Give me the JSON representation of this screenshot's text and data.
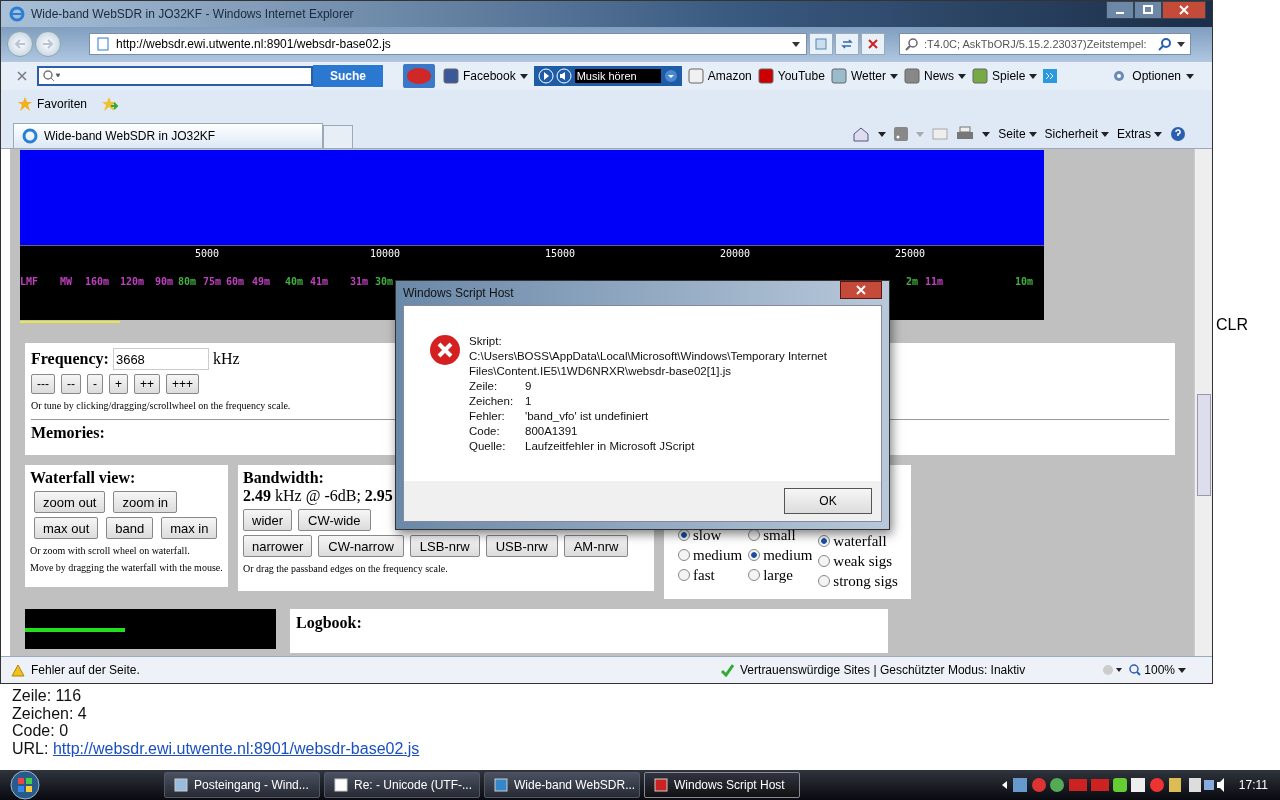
{
  "background_window": {
    "lines": [
      "Zeile: 116",
      "Zeichen: 4",
      "Code: 0"
    ],
    "url_label": "URL:",
    "url": "http://websdr.ewi.utwente.nl:8901/websdr-base02.js",
    "side_text": "CLR"
  },
  "ie_window": {
    "title": "Wide-band WebSDR in JO32KF - Windows Internet Explorer",
    "address": "http://websdr.ewi.utwente.nl:8901/websdr-base02.js",
    "search_value": ":T4.0C; AskTbORJ/5.15.2.23037)Zeitstempel:"
  },
  "toolbar": {
    "search_button": "Suche",
    "music": "Musik hören",
    "options": "Optionen",
    "items": [
      {
        "label": "Facebook",
        "kind": "dropdown"
      },
      {
        "label": "Amazon",
        "kind": "link"
      },
      {
        "label": "YouTube",
        "kind": "link"
      },
      {
        "label": "Wetter",
        "kind": "dropdown"
      },
      {
        "label": "News",
        "kind": "dropdown"
      },
      {
        "label": "Spiele",
        "kind": "dropdown"
      }
    ]
  },
  "favorites": {
    "label": "Favoriten"
  },
  "tabs": [
    {
      "label": "Wide-band WebSDR in JO32KF",
      "selected": true
    }
  ],
  "command_bar": [
    "Seite",
    "Sicherheit",
    "Extras"
  ],
  "page": {
    "scale": [
      "5000",
      "10000",
      "15000",
      "20000",
      "25000"
    ],
    "bands": [
      {
        "label": "LMF",
        "color": "#c040c0"
      },
      {
        "label": "MW",
        "color": "#c040c0"
      },
      {
        "label": "160m",
        "color": "#c040c0"
      },
      {
        "label": "120m",
        "color": "#c040c0"
      },
      {
        "label": "90m",
        "color": "#c040c0"
      },
      {
        "label": "80m",
        "color": "#40b040"
      },
      {
        "label": "75m",
        "color": "#c040c0"
      },
      {
        "label": "60m",
        "color": "#c040c0"
      },
      {
        "label": "49m",
        "color": "#c040c0"
      },
      {
        "label": "40m",
        "color": "#40b040"
      },
      {
        "label": "41m",
        "color": "#c040c0"
      },
      {
        "label": "31m",
        "color": "#c040c0"
      },
      {
        "label": "30m",
        "color": "#40b040"
      },
      {
        "label": "2m",
        "color": "#40b040"
      },
      {
        "label": "11m",
        "color": "#c040c0"
      },
      {
        "label": "10m",
        "color": "#40b040"
      }
    ],
    "frequency": {
      "label": "Frequency:",
      "value": "3668",
      "unit": "kHz",
      "buttons": [
        "---",
        "--",
        "-",
        "+",
        "++",
        "+++"
      ],
      "hint": "Or tune by clicking/dragging/scrollwheel on the frequency scale."
    },
    "memories": "Memories:",
    "waterfall": {
      "title": "Waterfall view:",
      "button_rows": [
        [
          "zoom out",
          "zoom in"
        ],
        [
          "max out",
          "band",
          "max in"
        ]
      ],
      "hints": [
        "Or zoom with scroll wheel on waterfall.",
        "Move by dragging the waterfall with the mouse."
      ]
    },
    "bandwidth": {
      "title": "Bandwidth:",
      "reading": "**2.49** kHz @ -6dB; **2.95**",
      "button_rows": [
        [
          "wider",
          "CW-wide"
        ],
        [
          "narrower",
          "CW-narrow",
          "LSB-nrw",
          "USB-nrw",
          "AM-nrw"
        ]
      ],
      "hint": "Or drag the passband edges on the frequency scale."
    },
    "radio_columns": [
      [
        {
          "label": "slow",
          "selected": true
        },
        {
          "label": "medium",
          "selected": false
        },
        {
          "label": "fast",
          "selected": false
        }
      ],
      [
        {
          "label": "small",
          "selected": false
        },
        {
          "label": "medium",
          "selected": true
        },
        {
          "label": "large",
          "selected": false
        }
      ],
      [
        {
          "label": "waterfall",
          "selected": true
        },
        {
          "label": "weak sigs",
          "selected": false
        },
        {
          "label": "strong sigs",
          "selected": false
        }
      ]
    ],
    "smeter": {
      "level": 0.4
    },
    "logbook": "Logbook:"
  },
  "status_bar": {
    "message": "Fehler auf der Seite.",
    "zone": "Vertrauenswürdige Sites | Geschützter Modus: Inaktiv",
    "zoom": "100%"
  },
  "dialog": {
    "title": "Windows Script Host",
    "rows": [
      {
        "label": "Skript:",
        "value": "C:\\Users\\BOSS\\AppData\\Local\\Microsoft\\Windows\\Temporary Internet Files\\Content.IE5\\1WD6NRXR\\websdr-base02[1].js"
      },
      {
        "label": "Zeile:",
        "value": "9"
      },
      {
        "label": "Zeichen:",
        "value": "1"
      },
      {
        "label": "Fehler:",
        "value": "'band_vfo' ist undefiniert"
      },
      {
        "label": "Code:",
        "value": "800A1391"
      },
      {
        "label": "Quelle:",
        "value": "Laufzeitfehler in Microsoft JScript"
      }
    ],
    "button": "OK"
  },
  "taskbar": {
    "items": [
      {
        "label": "Posteingang - Wind...",
        "selected": false
      },
      {
        "label": "Re:  - Unicode (UTF-...",
        "selected": false
      },
      {
        "label": "Wide-band WebSDR...",
        "selected": false
      },
      {
        "label": "Windows Script Host",
        "selected": true
      }
    ],
    "time": "17:11"
  }
}
